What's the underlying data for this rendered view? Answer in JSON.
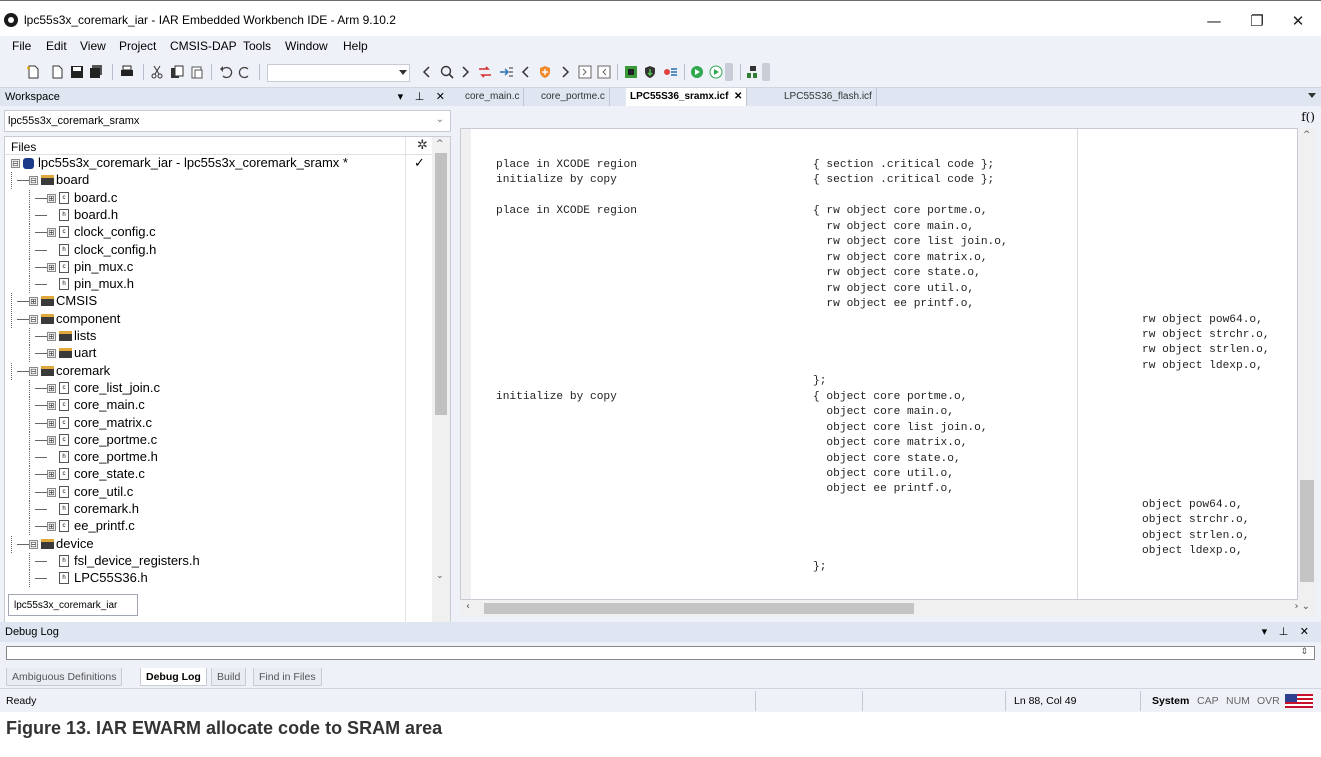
{
  "window": {
    "title": "lpc55s3x_coremark_iar - IAR Embedded Workbench IDE - Arm 9.10.2",
    "minimize": "—",
    "restore": "❐",
    "close": "✕"
  },
  "menu": [
    "File",
    "Edit",
    "View",
    "Project",
    "CMSIS-DAP",
    "Tools",
    "Window",
    "Help"
  ],
  "workspace": {
    "header": "Workspace",
    "controls": "▾ ⊥ ✕",
    "configuration": "lpc55s3x_coremark_sramx",
    "files_header": "Files",
    "tab": "lpc55s3x_coremark_iar",
    "check": "✓",
    "tree": [
      {
        "label": "lpc55s3x_coremark_iar - lpc55s3x_coremark_sramx *",
        "type": "project",
        "expander": "⊟"
      },
      {
        "label": "board",
        "type": "folder",
        "expander": "⊟"
      },
      {
        "label": "board.c",
        "type": "c",
        "expander": "⊞"
      },
      {
        "label": "board.h",
        "type": "h",
        "expander": ""
      },
      {
        "label": "clock_config.c",
        "type": "c",
        "expander": "⊞"
      },
      {
        "label": "clock_config.h",
        "type": "h",
        "expander": ""
      },
      {
        "label": "pin_mux.c",
        "type": "c",
        "expander": "⊞"
      },
      {
        "label": "pin_mux.h",
        "type": "h",
        "expander": ""
      },
      {
        "label": "CMSIS",
        "type": "folder",
        "expander": "⊞"
      },
      {
        "label": "component",
        "type": "folder",
        "expander": "⊟"
      },
      {
        "label": "lists",
        "type": "folder",
        "expander": "⊞"
      },
      {
        "label": "uart",
        "type": "folder",
        "expander": "⊞"
      },
      {
        "label": "coremark",
        "type": "folder",
        "expander": "⊟"
      },
      {
        "label": "core_list_join.c",
        "type": "c",
        "expander": "⊞"
      },
      {
        "label": "core_main.c",
        "type": "c",
        "expander": "⊞"
      },
      {
        "label": "core_matrix.c",
        "type": "c",
        "expander": "⊞"
      },
      {
        "label": "core_portme.c",
        "type": "c",
        "expander": "⊞"
      },
      {
        "label": "core_portme.h",
        "type": "h",
        "expander": ""
      },
      {
        "label": "core_state.c",
        "type": "c",
        "expander": "⊞"
      },
      {
        "label": "core_util.c",
        "type": "c",
        "expander": "⊞"
      },
      {
        "label": "coremark.h",
        "type": "h",
        "expander": ""
      },
      {
        "label": "ee_printf.c",
        "type": "c",
        "expander": "⊞"
      },
      {
        "label": "device",
        "type": "folder",
        "expander": "⊟"
      },
      {
        "label": "fsl_device_registers.h",
        "type": "h",
        "expander": ""
      },
      {
        "label": "LPC55S36.h",
        "type": "h",
        "expander": ""
      }
    ]
  },
  "editor": {
    "tabs": [
      {
        "label": "core_main.c",
        "active": false
      },
      {
        "label": "core_portme.c",
        "active": false
      },
      {
        "label": "LPC55S36_sramx.icf",
        "active": true
      },
      {
        "label": "LPC55S36_flash.icf",
        "active": false
      }
    ],
    "tab_close": "✕",
    "function_button": "f()",
    "code_lines": [
      {
        "col": "a",
        "row": 0,
        "text": "place in XCODE region"
      },
      {
        "col": "b",
        "row": 0,
        "text": "{ section .critical code };"
      },
      {
        "col": "a",
        "row": 1,
        "text": "initialize by copy"
      },
      {
        "col": "b",
        "row": 1,
        "text": "{ section .critical code };"
      },
      {
        "col": "a",
        "row": 3,
        "text": "place in XCODE region"
      },
      {
        "col": "b",
        "row": 3,
        "text": "{ rw object core portme.o,"
      },
      {
        "col": "b",
        "row": 4,
        "text": "  rw object core main.o,"
      },
      {
        "col": "b",
        "row": 5,
        "text": "  rw object core list join.o,"
      },
      {
        "col": "b",
        "row": 6,
        "text": "  rw object core matrix.o,"
      },
      {
        "col": "b",
        "row": 7,
        "text": "  rw object core state.o,"
      },
      {
        "col": "b",
        "row": 8,
        "text": "  rw object core util.o,"
      },
      {
        "col": "b",
        "row": 9,
        "text": "  rw object ee printf.o,"
      },
      {
        "col": "c",
        "row": 10,
        "text": "rw object pow64.o,"
      },
      {
        "col": "c",
        "row": 11,
        "text": "rw object strchr.o,"
      },
      {
        "col": "c",
        "row": 12,
        "text": "rw object strlen.o,"
      },
      {
        "col": "c",
        "row": 13,
        "text": "rw object ldexp.o,"
      },
      {
        "col": "b",
        "row": 14,
        "text": "};"
      },
      {
        "col": "a",
        "row": 15,
        "text": "initialize by copy"
      },
      {
        "col": "b",
        "row": 15,
        "text": "{ object core portme.o,"
      },
      {
        "col": "b",
        "row": 16,
        "text": "  object core main.o,"
      },
      {
        "col": "b",
        "row": 17,
        "text": "  object core list join.o,"
      },
      {
        "col": "b",
        "row": 18,
        "text": "  object core matrix.o,"
      },
      {
        "col": "b",
        "row": 19,
        "text": "  object core state.o,"
      },
      {
        "col": "b",
        "row": 20,
        "text": "  object core util.o,"
      },
      {
        "col": "b",
        "row": 21,
        "text": "  object ee printf.o,"
      },
      {
        "col": "c",
        "row": 22,
        "text": "object pow64.o,"
      },
      {
        "col": "c",
        "row": 23,
        "text": "object strchr.o,"
      },
      {
        "col": "c",
        "row": 24,
        "text": "object strlen.o,"
      },
      {
        "col": "c",
        "row": 25,
        "text": "object ldexp.o,"
      },
      {
        "col": "b",
        "row": 26,
        "text": "};"
      }
    ]
  },
  "debug_log": {
    "header": "Debug Log",
    "controls": "▾ ⊥ ✕",
    "tabs": [
      {
        "label": "Ambiguous Definitions",
        "active": false
      },
      {
        "label": "Debug Log",
        "active": true
      },
      {
        "label": "Build",
        "active": false
      },
      {
        "label": "Find in Files",
        "active": false
      }
    ]
  },
  "status": {
    "ready": "Ready",
    "position": "Ln 88, Col 49",
    "system": "System",
    "cap": "CAP",
    "num": "NUM",
    "ovr": "OVR"
  },
  "caption": "Figure 13.  IAR EWARM allocate code to SRAM area"
}
